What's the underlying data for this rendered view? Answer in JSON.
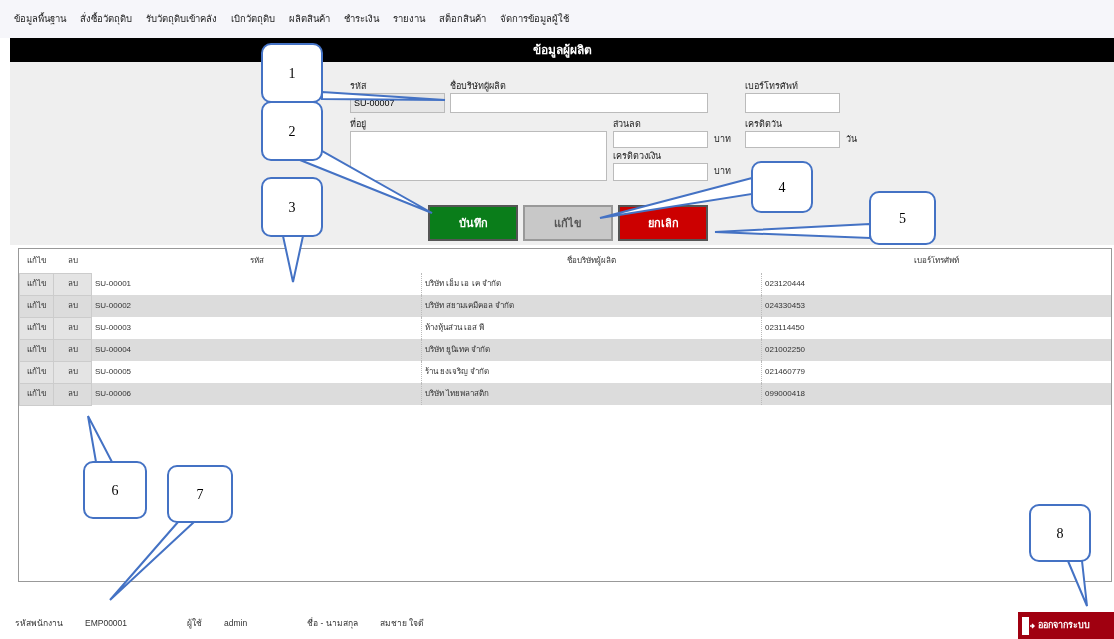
{
  "menu": [
    "ข้อมูลพื้นฐาน",
    "สั่งซื้อวัตถุดิบ",
    "รับวัตถุดิบเข้าคลัง",
    "เบิกวัตถุดิบ",
    "ผลิตสินค้า",
    "ชำระเงิน",
    "รายงาน",
    "สต็อกสินค้า",
    "จัดการข้อมูลผู้ใช้"
  ],
  "title": "ข้อมูลผู้ผลิต",
  "form": {
    "code": {
      "label": "รหัส",
      "value": "SU-00007"
    },
    "name": {
      "label": "ชื่อบริษัทผู้ผลิต"
    },
    "phone": {
      "label": "เบอร์โทรศัพท์"
    },
    "address": {
      "label": "ที่อยู่"
    },
    "discount": {
      "label": "ส่วนลด",
      "unit": "บาท"
    },
    "credit_days": {
      "label": "เครดิตวัน",
      "unit": "วัน"
    },
    "credit_limit": {
      "label": "เครดิตวงเงิน",
      "unit": "บาท"
    }
  },
  "buttons": [
    {
      "kind": "save",
      "label": "บันทึก"
    },
    {
      "kind": "edit",
      "label": "แก้ไข"
    },
    {
      "kind": "cancel",
      "label": "ยกเลิก"
    }
  ],
  "table": {
    "columns": [
      "แก้ไข",
      "ลบ",
      "รหัส",
      "ชื่อบริษัทผู้ผลิต",
      "เบอร์โทรศัพท์"
    ],
    "rows": [
      {
        "edit": "แก้ไข",
        "delete": "ลบ",
        "code": "SU-00001",
        "name": "บริษัท เอ็ม เอ เค จำกัด",
        "phone": "023120444"
      },
      {
        "edit": "แก้ไข",
        "delete": "ลบ",
        "code": "SU-00002",
        "name": "บริษัท สยามเคมีคอล จำกัด",
        "phone": "024330453"
      },
      {
        "edit": "แก้ไข",
        "delete": "ลบ",
        "code": "SU-00003",
        "name": "ห้างหุ้นส่วน เอส พี",
        "phone": "023114450"
      },
      {
        "edit": "แก้ไข",
        "delete": "ลบ",
        "code": "SU-00004",
        "name": "บริษัท ยูนิเทค จำกัด",
        "phone": "021002250"
      },
      {
        "edit": "แก้ไข",
        "delete": "ลบ",
        "code": "SU-00005",
        "name": "ร้าน ยงเจริญ จำกัด",
        "phone": "021460779"
      },
      {
        "edit": "แก้ไข",
        "delete": "ลบ",
        "code": "SU-00006",
        "name": "บริษัท ไทยพลาสติก",
        "phone": "099000418"
      }
    ]
  },
  "status_bar": [
    {
      "label": "รหัสพนักงาน",
      "value": "EMP00001"
    },
    {
      "label": "ผู้ใช้",
      "value": "admin"
    },
    {
      "label": "ชื่อ - นามสกุล",
      "value": "สมชาย ใจดี"
    }
  ],
  "logout": {
    "label": "ออกจากระบบ"
  },
  "callouts": [
    {
      "label": "1"
    },
    {
      "label": "2"
    },
    {
      "label": "3"
    },
    {
      "label": "4"
    },
    {
      "label": "5"
    },
    {
      "label": "6"
    },
    {
      "label": "7"
    },
    {
      "label": "8"
    }
  ]
}
